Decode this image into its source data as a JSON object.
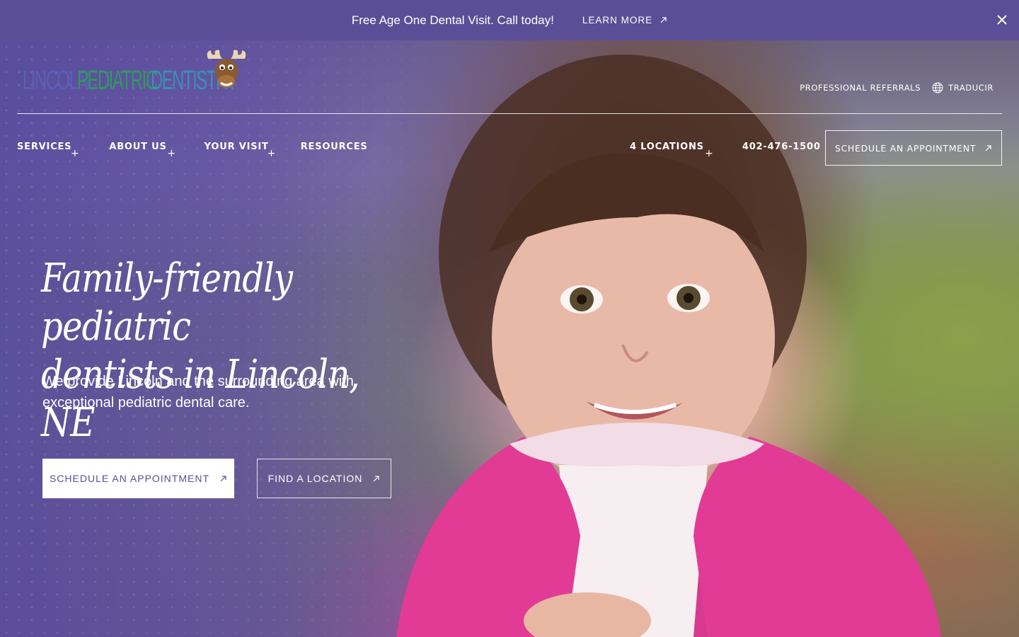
{
  "announcement": {
    "message": "Free Age One Dental Visit. Call today!",
    "link_label": "LEARN MORE",
    "close_icon": "close-icon"
  },
  "brand": {
    "logo_word1": "LINCOLN",
    "logo_word2": "PEDIATRIC",
    "logo_word3": "DENTISTRY",
    "logo_mascot": "moose-icon"
  },
  "utility_nav": {
    "referrals": "PROFESSIONAL REFERRALS",
    "translate": "TRADUCIR",
    "translate_icon": "globe-icon"
  },
  "main_nav": {
    "items": [
      {
        "label": "SERVICES",
        "expandable": true
      },
      {
        "label": "ABOUT US",
        "expandable": true
      },
      {
        "label": "YOUR VISIT",
        "expandable": true
      },
      {
        "label": "RESOURCES",
        "expandable": false
      }
    ],
    "locations": "4 LOCATIONS",
    "phone": "402-476-1500",
    "appointment": "SCHEDULE AN APPOINTMENT"
  },
  "hero": {
    "headline_line1": "Family-friendly pediatric",
    "headline_line2": "dentists in Lincoln, NE",
    "subtext": "We provide Lincoln and the surrounding area with exceptional pediatric dental care.",
    "primary_cta": "SCHEDULE AN APPOINTMENT",
    "secondary_cta": "FIND A LOCATION"
  },
  "colors": {
    "brand_purple": "#5a4f96",
    "white": "#ffffff"
  }
}
